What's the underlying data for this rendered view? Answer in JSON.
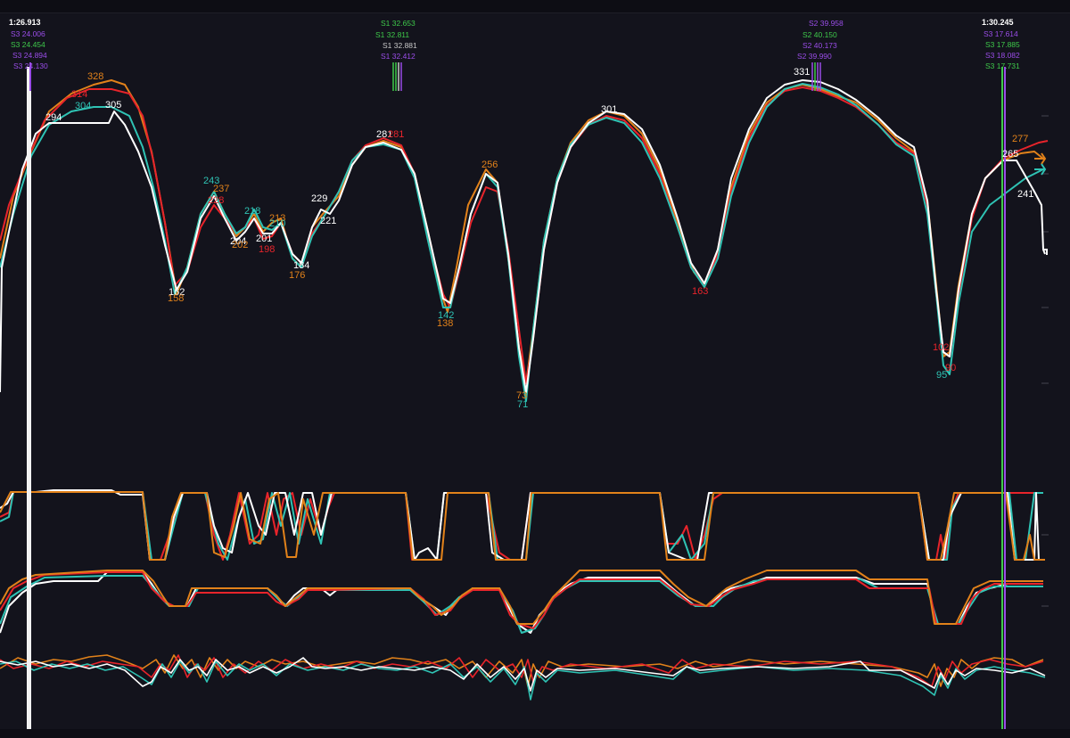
{
  "colors": {
    "background": "#13131c",
    "white": "#ffffff",
    "red": "#e8242b",
    "cyan": "#2fc3b4",
    "orange": "#e2821a",
    "purple": "#9a4de8",
    "green": "#3ec94a",
    "grey": "#c8c8c8"
  },
  "cursor_left": {
    "title": "1:26.913",
    "labels": [
      {
        "text": "S3 24.006",
        "color": "purple"
      },
      {
        "text": "S3 24.454",
        "color": "green"
      },
      {
        "text": "S3 24.894",
        "color": "purple"
      },
      {
        "text": "S3 24.130",
        "color": "purple"
      }
    ]
  },
  "cursor_right": {
    "title": "1:30.245",
    "labels": [
      {
        "text": "S3 17.614",
        "color": "purple"
      },
      {
        "text": "S3 17.885",
        "color": "green"
      },
      {
        "text": "S3 18.082",
        "color": "purple"
      },
      {
        "text": "S3 17.731",
        "color": "green"
      }
    ]
  },
  "sector1_labels": [
    {
      "text": "S1 32.653",
      "color": "green"
    },
    {
      "text": "S1 32.811",
      "color": "green"
    },
    {
      "text": "S1 32.881",
      "color": "grey"
    },
    {
      "text": "S1 32.412",
      "color": "purple"
    }
  ],
  "sector2_labels": [
    {
      "text": "S2 39.958",
      "color": "purple"
    },
    {
      "text": "S2 40.150",
      "color": "green"
    },
    {
      "text": "S2 40.173",
      "color": "purple"
    },
    {
      "text": "S2 39.990",
      "color": "purple"
    }
  ],
  "speed_labels": [
    {
      "text": "328",
      "color": "orange"
    },
    {
      "text": "314",
      "color": "red"
    },
    {
      "text": "304",
      "color": "cyan"
    },
    {
      "text": "305",
      "color": "white"
    },
    {
      "text": "294",
      "color": "white"
    },
    {
      "text": "243",
      "color": "cyan"
    },
    {
      "text": "237",
      "color": "orange"
    },
    {
      "text": "228",
      "color": "red"
    },
    {
      "text": "218",
      "color": "cyan"
    },
    {
      "text": "213",
      "color": "orange"
    },
    {
      "text": "210",
      "color": "cyan"
    },
    {
      "text": "204",
      "color": "white"
    },
    {
      "text": "202",
      "color": "orange"
    },
    {
      "text": "201",
      "color": "white"
    },
    {
      "text": "198",
      "color": "red"
    },
    {
      "text": "229",
      "color": "white"
    },
    {
      "text": "221",
      "color": "white"
    },
    {
      "text": "184",
      "color": "white"
    },
    {
      "text": "176",
      "color": "orange"
    },
    {
      "text": "162",
      "color": "white"
    },
    {
      "text": "158",
      "color": "orange"
    },
    {
      "text": "281",
      "color": "white"
    },
    {
      "text": "281",
      "color": "red"
    },
    {
      "text": "256",
      "color": "orange"
    },
    {
      "text": "142",
      "color": "cyan"
    },
    {
      "text": "138",
      "color": "orange"
    },
    {
      "text": "73",
      "color": "orange"
    },
    {
      "text": "71",
      "color": "cyan"
    },
    {
      "text": "301",
      "color": "white"
    },
    {
      "text": "163",
      "color": "red"
    },
    {
      "text": "331",
      "color": "white"
    },
    {
      "text": "277",
      "color": "orange"
    },
    {
      "text": "265",
      "color": "white"
    },
    {
      "text": "241",
      "color": "white"
    },
    {
      "text": "102",
      "color": "red"
    },
    {
      "text": "95",
      "color": "cyan"
    },
    {
      "text": "90",
      "color": "red"
    }
  ],
  "traces": {
    "speed": [
      {
        "name": "white",
        "color": "white"
      },
      {
        "name": "red",
        "color": "red"
      },
      {
        "name": "cyan",
        "color": "cyan"
      },
      {
        "name": "orange",
        "color": "orange"
      }
    ]
  }
}
